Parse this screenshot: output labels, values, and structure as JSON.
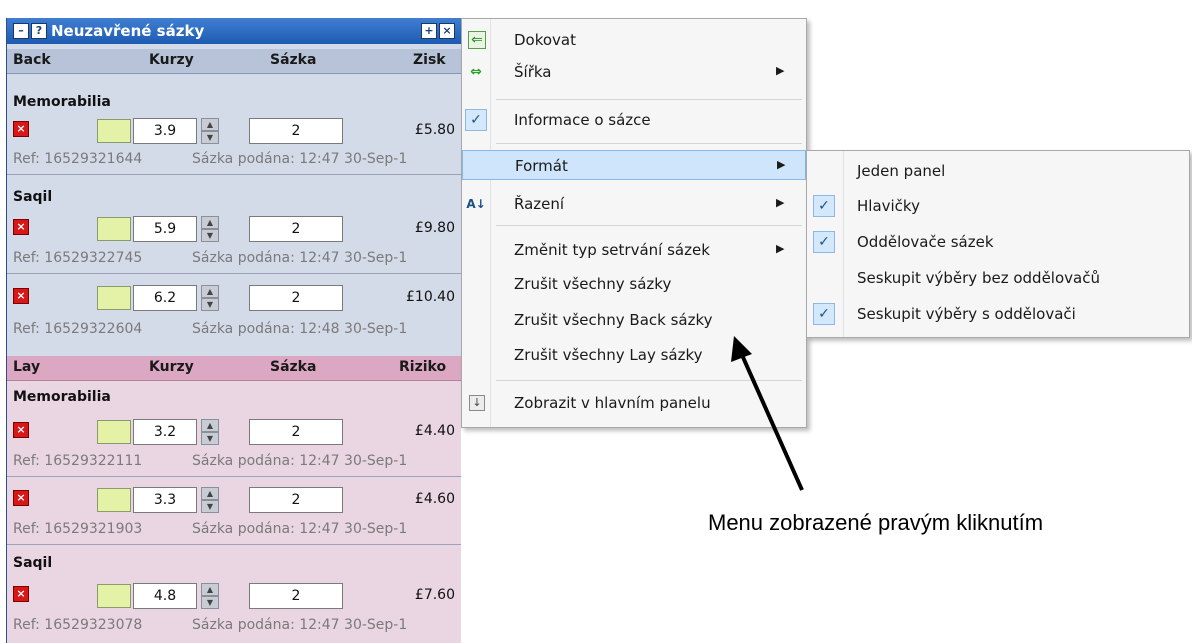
{
  "window": {
    "title": "Neuzavřené sázky",
    "title_icons": [
      "?"
    ],
    "close_icons": [
      "+",
      "×"
    ]
  },
  "back_header": {
    "col1": "Back",
    "col2": "Kurzy",
    "col3": "Sázka",
    "col4": "Zisk"
  },
  "lay_header": {
    "col1": "Lay",
    "col2": "Kurzy",
    "col3": "Sázka",
    "col4": "Riziko"
  },
  "back_bets": {
    "sel1": "Memorabilia",
    "b1": {
      "odds": "3.9",
      "stake": "2",
      "profit": "£5.80",
      "ref": "Ref: 16529321644",
      "placed": "Sázka podána: 12:47  30-Sep-1"
    },
    "sel2": "Saqil",
    "b2": {
      "odds": "5.9",
      "stake": "2",
      "profit": "£9.80",
      "ref": "Ref: 16529322745",
      "placed": "Sázka podána: 12:47  30-Sep-1"
    },
    "b3": {
      "odds": "6.2",
      "stake": "2",
      "profit": "£10.40",
      "ref": "Ref: 16529322604",
      "placed": "Sázka podána: 12:48  30-Sep-1"
    }
  },
  "lay_bets": {
    "sel1": "Memorabilia",
    "b1": {
      "odds": "3.2",
      "stake": "2",
      "profit": "£4.40",
      "ref": "Ref: 16529322111",
      "placed": "Sázka podána: 12:47  30-Sep-1"
    },
    "b2": {
      "odds": "3.3",
      "stake": "2",
      "profit": "£4.60",
      "ref": "Ref: 16529321903",
      "placed": "Sázka podána: 12:47  30-Sep-1"
    },
    "sel2": "Saqil",
    "b3": {
      "odds": "4.8",
      "stake": "2",
      "profit": "£7.60",
      "ref": "Ref: 16529323078",
      "placed": "Sázka podána: 12:47  30-Sep-1"
    }
  },
  "context_menu": {
    "dock": "Dokovat",
    "width": "Šířka",
    "bet_info": "Informace o sázce",
    "format": "Formát",
    "sort": "Řazení",
    "change_persistence": "Změnit typ setrvání sázek",
    "cancel_all": "Zrušit všechny sázky",
    "cancel_back": "Zrušit všechny Back sázky",
    "cancel_lay": "Zrušit všechny Lay sázky",
    "show_main": "Zobrazit v hlavním panelu"
  },
  "format_submenu": {
    "single_panel": "Jeden panel",
    "headers": "Hlavičky",
    "bet_separators": "Oddělovače sázek",
    "group_no_sep": "Seskupit výběry bez oddělovačů",
    "group_with_sep": "Seskupit výběry s oddělovači"
  },
  "annotation": "Menu zobrazené pravým kliknutím",
  "colors": {
    "title_bar": "#1e5cb3",
    "back_bg": "#d4dbe8",
    "lay_bg": "#ead6e2",
    "menu_highlight": "#cfe5fb",
    "cancel_red": "#d81818"
  }
}
